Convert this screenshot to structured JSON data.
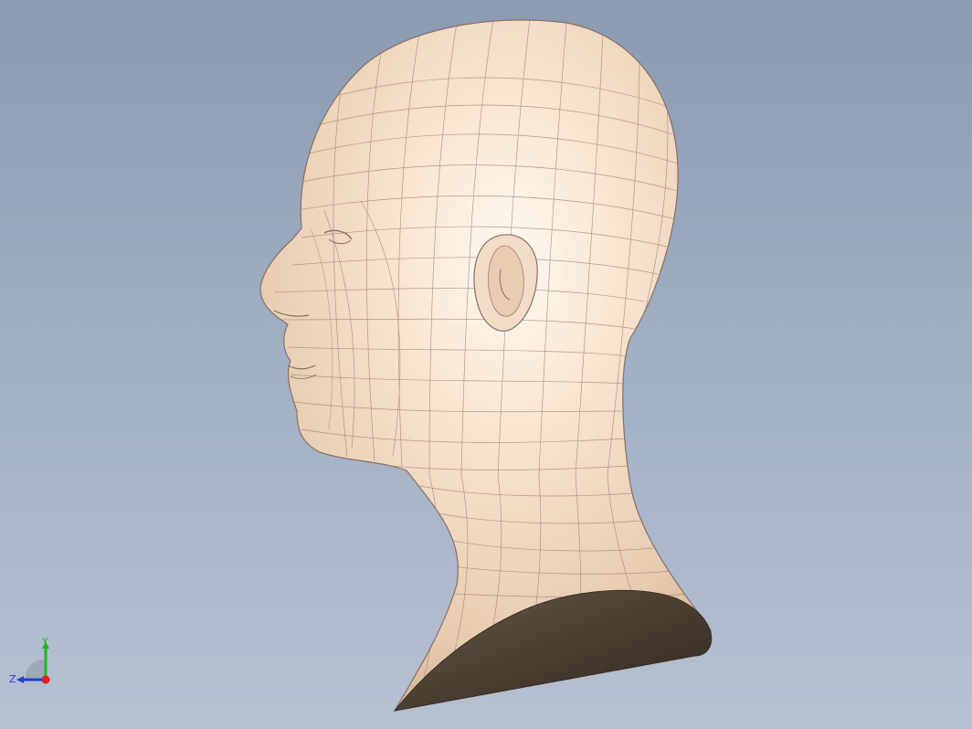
{
  "viewport": {
    "background_top": "#8a9bb2",
    "background_bottom": "#b6c0d1"
  },
  "model": {
    "icon": "head-bust-3d-model",
    "surface_color": "#f4dcc6",
    "wire_color": "#a37d7a",
    "base_cut_color": "#4a3e30"
  },
  "triad": {
    "icon": "coordinate-axes-triad-icon",
    "y_label": "Y",
    "z_label": "Z",
    "y_color": "#1fb81f",
    "z_color": "#1f3fd6",
    "x_color": "#e02020"
  }
}
